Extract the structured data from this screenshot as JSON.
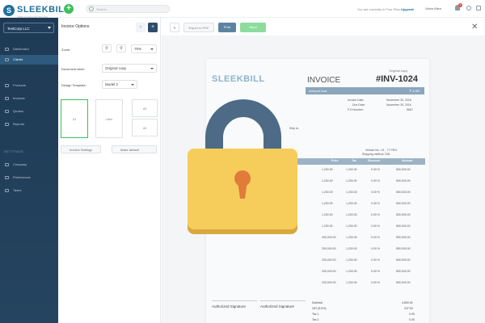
{
  "app": {
    "logo_mark": "S",
    "logo_name": "SLEEKBILL",
    "logo_tag": "SIMPLE ELEGANT BILLING",
    "add_symbol": "+",
    "search_placeholder": "Search",
    "plan_text": "You are currently in Free Plan",
    "plan_link": "Upgrade",
    "user_name": "Victor Allen",
    "notification_count": "1"
  },
  "sidebar": {
    "company": "TestCorp LLC",
    "items": [
      {
        "label": "Dashboard",
        "active": false
      },
      {
        "label": "Clients",
        "active": true
      },
      {
        "label": "Products",
        "active": false
      },
      {
        "label": "Invoices",
        "active": false
      },
      {
        "label": "Quotes",
        "active": false
      },
      {
        "label": "Reports",
        "active": false
      }
    ],
    "settings_heading": "SETTINGS",
    "settings_items": [
      {
        "label": "Company"
      },
      {
        "label": "Preferences"
      },
      {
        "label": "Taxes"
      }
    ]
  },
  "options": {
    "title": "Invoice Options",
    "zoom_label": "Zoom:",
    "zoom_value": "75%",
    "document_label_label": "Document label:",
    "document_label_value": "Original copy",
    "design_template_label": "Design Template:",
    "design_template_value": "Model 2",
    "paper_sizes": [
      "A4",
      "Letter",
      "A5",
      "A5"
    ],
    "invoice_settings_btn": "Invoice Settings",
    "make_default_btn": "Make default"
  },
  "toolbar": {
    "export_pdf": "Export to PDF",
    "print": "Print",
    "send": "Send"
  },
  "invoice": {
    "original_copy": "Original copy",
    "logo": "SLEEKBILL",
    "title": "INVOICE",
    "number": "#INV-1024",
    "amount_due_label": "Amount Due:",
    "amount_due_value": "₹ 4,987",
    "meta": [
      {
        "label": "Invoice Date:",
        "value": "November 30, 2016"
      },
      {
        "label": "Due Date:",
        "value": "November 30, 2016"
      },
      {
        "label": "P.O Number:",
        "value": "5667"
      }
    ],
    "ship_to": "Ship to:",
    "vehicle_no": "Vehicle No.: 01 - 77 PRO",
    "shipping_method": "Shipping method: DHL",
    "columns": [
      "Price",
      "Tax",
      "Discount",
      "Amount"
    ],
    "rows": [
      {
        "price": "1,200.00",
        "tax": "1,200.00",
        "discount": "0.00 %",
        "amount": "550,000.00"
      },
      {
        "price": "1,200.00",
        "tax": "1,200.00",
        "discount": "0.00 %",
        "amount": "550,000.00"
      },
      {
        "price": "1,200.00",
        "tax": "1,200.00",
        "discount": "0.00 %",
        "amount": "550,000.00"
      },
      {
        "price": "1,200.00",
        "tax": "1,200.00",
        "discount": "0.00 %",
        "amount": "550,000.00"
      },
      {
        "price": "1,200.00",
        "tax": "1,200.00",
        "discount": "0.00 %",
        "amount": "550,000.00"
      },
      {
        "price": "1,200.00",
        "tax": "1,200.00",
        "discount": "0.00 %",
        "amount": "550,000.00"
      },
      {
        "price": "200,000.00",
        "tax": "1,200.00",
        "discount": "0.00 %",
        "amount": "550,000.00"
      },
      {
        "price": "200,000.00",
        "tax": "1,200.00",
        "discount": "0.00 %",
        "amount": "550,000.00"
      },
      {
        "price": "200,000.00",
        "tax": "1,200.00",
        "discount": "0.00 %",
        "amount": "550,000.00"
      },
      {
        "price": "200,000.00",
        "tax": "1,200.00",
        "discount": "0.00 %",
        "amount": "550,000.00"
      },
      {
        "price": "200,000.00",
        "tax": "1,200.00",
        "discount": "0.00 %",
        "amount": "550,000.00"
      }
    ],
    "signature_left": "Authorized Signature",
    "signature_right": "Authorized Signature",
    "totals": [
      {
        "label": "Subtotal",
        "value": "4,500.00"
      },
      {
        "label": "VAT (5.5%)",
        "value": "247.00"
      },
      {
        "label": "Tax 1",
        "value": "0.00"
      },
      {
        "label": "Tax 2",
        "value": "0.00"
      }
    ]
  },
  "overlay": {
    "icon": "lock-icon",
    "body_color": "#f6cd5b",
    "shackle_color": "#4d6b87",
    "keyhole_color": "#e07b3a"
  }
}
